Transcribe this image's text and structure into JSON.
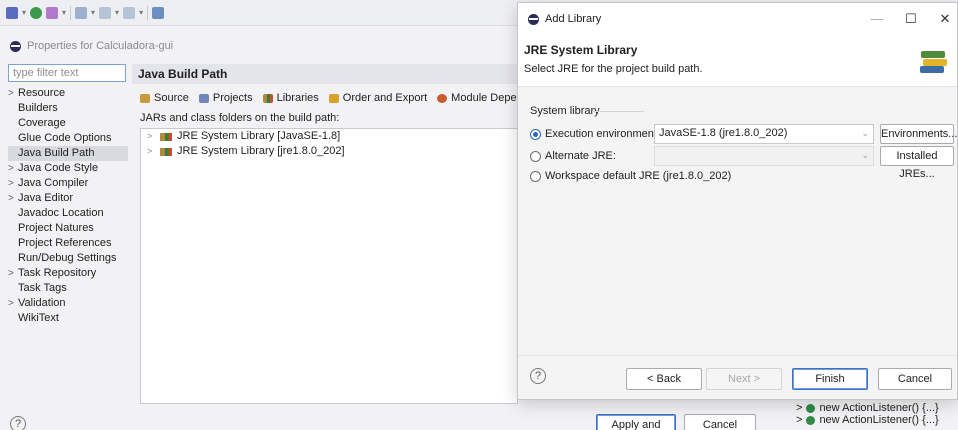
{
  "toolbar": {
    "icons": [
      "eclipse-debug-icon",
      "run-icon",
      "tools-icon",
      "refresh-icon",
      "nav-back-icon",
      "nav-forward-icon",
      "edit-icon"
    ]
  },
  "properties": {
    "window_title": "Properties for Calculadora-gui",
    "filter_placeholder": "type filter text",
    "tree": [
      {
        "label": "Resource",
        "chev": ">",
        "indent": false
      },
      {
        "label": "Builders",
        "chev": "",
        "indent": true
      },
      {
        "label": "Coverage",
        "chev": "",
        "indent": true
      },
      {
        "label": "Glue Code Options",
        "chev": "",
        "indent": true
      },
      {
        "label": "Java Build Path",
        "chev": "",
        "indent": true,
        "selected": true
      },
      {
        "label": "Java Code Style",
        "chev": ">",
        "indent": false
      },
      {
        "label": "Java Compiler",
        "chev": ">",
        "indent": false
      },
      {
        "label": "Java Editor",
        "chev": ">",
        "indent": false
      },
      {
        "label": "Javadoc Location",
        "chev": "",
        "indent": true
      },
      {
        "label": "Project Natures",
        "chev": "",
        "indent": true
      },
      {
        "label": "Project References",
        "chev": "",
        "indent": true
      },
      {
        "label": "Run/Debug Settings",
        "chev": "",
        "indent": true
      },
      {
        "label": "Task Repository",
        "chev": ">",
        "indent": false
      },
      {
        "label": "Task Tags",
        "chev": "",
        "indent": true
      },
      {
        "label": "Validation",
        "chev": ">",
        "indent": false
      },
      {
        "label": "WikiText",
        "chev": "",
        "indent": true
      }
    ],
    "page_title": "Java Build Path",
    "tabs": {
      "source": "Source",
      "projects": "Projects",
      "libraries": "Libraries",
      "order": "Order and Export",
      "module": "Module Dependencie"
    },
    "jars_label": "JARs and class folders on the build path:",
    "libraries": [
      {
        "label": "JRE System Library [JavaSE-1.8]"
      },
      {
        "label": "JRE System Library [jre1.8.0_202]"
      }
    ],
    "help_label": "?",
    "apply_close_label": "Apply and Close",
    "cancel_label": "Cancel"
  },
  "outline": {
    "rows": [
      {
        "chev": ">",
        "label": "new ActionListener() {...}"
      },
      {
        "chev": ">",
        "label": "new ActionListener() {...}"
      }
    ]
  },
  "dialog": {
    "window_title": "Add Library",
    "minimize_label": "—",
    "maximize_label": "☐",
    "close_label": "✕",
    "header_title": "JRE System Library",
    "header_desc": "Select JRE for the project build path.",
    "group_label": "System library",
    "options": {
      "exec_env_label": "Execution environment:",
      "exec_env_value": "JavaSE-1.8 (jre1.8.0_202)",
      "environments_label": "Environments...",
      "alt_jre_label": "Alternate JRE:",
      "alt_jre_value": "",
      "installed_jres_label": "Installed JREs...",
      "workspace_label": "Workspace default JRE (jre1.8.0_202)",
      "selected": "execution_environment"
    },
    "footer": {
      "help_label": "?",
      "back_label": "< Back",
      "next_label": "Next >",
      "finish_label": "Finish",
      "cancel_label": "Cancel"
    }
  },
  "colors": {
    "accent": "#2a67c6",
    "selected_tree_bg": "#d9dadf",
    "page_title_bg": "#e4e5ea"
  }
}
